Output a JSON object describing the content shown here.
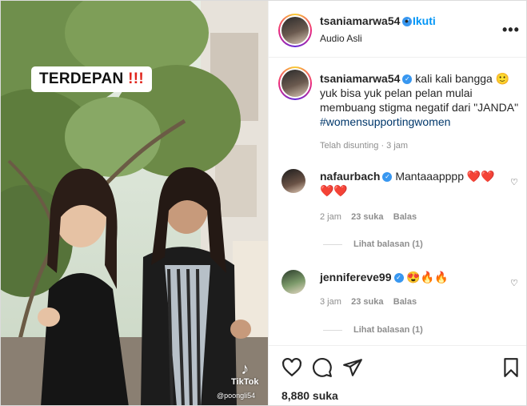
{
  "post": {
    "author": "tsaniamarwa54",
    "dot": "•",
    "follow_label": "Ikuti",
    "audio": "Audio Asli",
    "more_icon": "more-horizontal-icon",
    "caption_text": "kali kali bangga 🙂 yuk bisa yuk pelan pelan mulai membuang stigma negatif dari \"JANDA\"",
    "hashtag": "#womensupportingwomen",
    "edited_time": "Telah disunting · 3 jam"
  },
  "media": {
    "overlay_text": "TERDEPAN",
    "overlay_emph": "!!!",
    "watermark_app": "TikTok",
    "watermark_handle": "@poongli54"
  },
  "comments": [
    {
      "user": "nafaurbach",
      "text": "Mantaaapppp",
      "hearts": "❤️❤️❤️❤️",
      "time": "2 jam",
      "likes": "23 suka",
      "reply": "Balas",
      "view_replies": "Lihat balasan (1)"
    },
    {
      "user": "jennifereve99",
      "text": "😍🔥🔥",
      "time": "3 jam",
      "likes": "23 suka",
      "reply": "Balas",
      "view_replies": "Lihat balasan (1)"
    }
  ],
  "footer": {
    "likes": "8,880 suka"
  },
  "colors": {
    "accent": "#0095f6",
    "hashtag": "#00376b",
    "muted": "#8e8e8e",
    "verified": "#3897f0"
  }
}
